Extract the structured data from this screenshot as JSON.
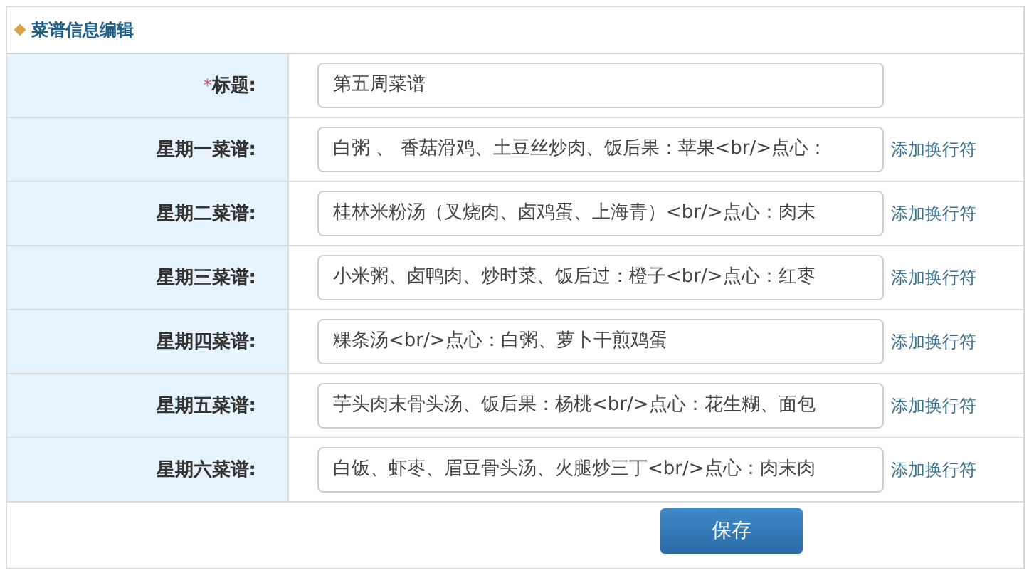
{
  "panel": {
    "title": "菜谱信息编辑"
  },
  "title_field": {
    "label": "标题:",
    "required_mark": "*",
    "value": "第五周菜谱"
  },
  "menu_rows": [
    {
      "label": "星期一菜谱:",
      "value": "白粥 、 香菇滑鸡、土豆丝炒肉、饭后果：苹果<br/>点心：",
      "link": "添加换行符"
    },
    {
      "label": "星期二菜谱:",
      "value": "桂林米粉汤（叉烧肉、卤鸡蛋、上海青）<br/>点心：肉末",
      "link": "添加换行符"
    },
    {
      "label": "星期三菜谱:",
      "value": "小米粥、卤鸭肉、炒时菜、饭后过：橙子<br/>点心：红枣",
      "link": "添加换行符"
    },
    {
      "label": "星期四菜谱:",
      "value": "粿条汤<br/>点心：白粥、萝卜干煎鸡蛋",
      "link": "添加换行符"
    },
    {
      "label": "星期五菜谱:",
      "value": "芋头肉末骨头汤、饭后果：杨桃<br/>点心：花生糊、面包",
      "link": "添加换行符"
    },
    {
      "label": "星期六菜谱:",
      "value": "白饭、虾枣、眉豆骨头汤、火腿炒三丁<br/>点心：肉末肉",
      "link": "添加换行符"
    }
  ],
  "buttons": [
    "保存"
  ]
}
